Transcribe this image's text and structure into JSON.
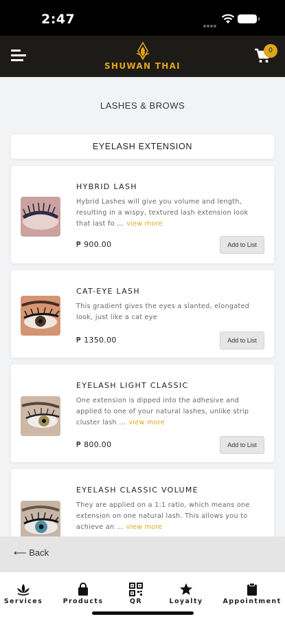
{
  "status_bar": {
    "time": "2:47"
  },
  "header": {
    "brand": "SHUWAN THAI",
    "cart_count": "0"
  },
  "page": {
    "title": "LASHES & BROWS",
    "section": "EYELASH EXTENSION"
  },
  "products": [
    {
      "name": "HYBRID LASH",
      "description": "Hybrid Lashes will give you volume and length, resulting in a wispy, textured lash extension look that last fo ...",
      "view_more": "view more",
      "price": "₱ 900.00",
      "button": "Add to List",
      "image_icon": "eyelash-photo-hybrid"
    },
    {
      "name": "CAT-EYE LASH",
      "description": "This gradient gives the eyes a slanted, elongated look, just like a cat eye",
      "view_more": "",
      "price": "₱ 1350.00",
      "button": "Add to List",
      "image_icon": "eyelash-photo-cat-eye"
    },
    {
      "name": "EYELASH LIGHT CLASSIC",
      "description": "One extension is dipped into the adhesive and applied to one of your natural lashes, unlike strip cluster lash ...",
      "view_more": "view more",
      "price": "₱ 800.00",
      "button": "Add to List",
      "image_icon": "eyelash-photo-light-classic"
    },
    {
      "name": "EYELASH CLASSIC VOLUME",
      "description": "They are applied on a 1:1 ratio, which means one extension on one natural lash. This allows you to achieve an ...",
      "view_more": "view more",
      "price": "",
      "button": "",
      "image_icon": "eyelash-photo-classic-volume"
    }
  ],
  "back": {
    "label": "Back"
  },
  "bottom_nav": [
    {
      "label": "Services",
      "icon": "lotus-icon"
    },
    {
      "label": "Products",
      "icon": "shopping-bag-icon"
    },
    {
      "label": "QR",
      "icon": "qr-code-icon"
    },
    {
      "label": "Loyalty",
      "icon": "star-icon"
    },
    {
      "label": "Appointment",
      "icon": "clipboard-icon"
    }
  ],
  "colors": {
    "accent": "#e0a51b",
    "header_bg": "#1c1b18",
    "page_bg": "#f2f3f5"
  }
}
